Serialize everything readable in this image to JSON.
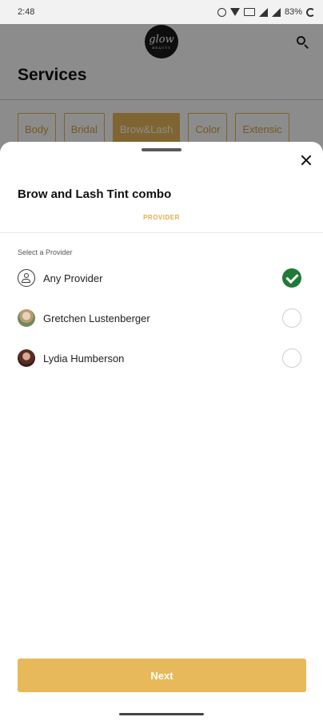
{
  "status_bar": {
    "time": "2:48",
    "battery": "83%"
  },
  "header": {
    "logo_text": "glow",
    "logo_subtext": "BEAUTY",
    "title": "Services"
  },
  "categories": [
    {
      "label": "Body",
      "active": false
    },
    {
      "label": "Bridal",
      "active": false
    },
    {
      "label": "Brow&Lash",
      "active": true
    },
    {
      "label": "Color",
      "active": false
    },
    {
      "label": "Extensic",
      "active": false
    }
  ],
  "sheet": {
    "title": "Brow and Lash Tint combo",
    "step_label": "PROVIDER",
    "section_label": "Select a Provider",
    "providers": [
      {
        "name": "Any Provider",
        "selected": true
      },
      {
        "name": "Gretchen Lustenberger",
        "selected": false
      },
      {
        "name": "Lydia Humberson",
        "selected": false
      }
    ],
    "next_label": "Next"
  },
  "colors": {
    "accent": "#e8b95a",
    "check": "#1f7a35"
  }
}
